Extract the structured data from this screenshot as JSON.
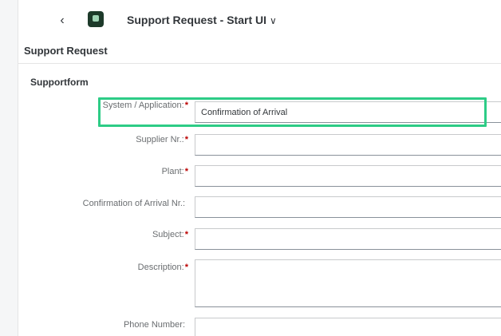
{
  "shell": {
    "back_icon": "chevron-left-icon",
    "app_icon": "app-logo-icon",
    "title": "Support Request - Start UI",
    "title_chevron": "∨"
  },
  "page": {
    "title": "Support Request"
  },
  "form": {
    "title": "Supportform",
    "fields": {
      "system": {
        "label": "System / Application:",
        "required": "*",
        "value": "Confirmation of Arrival"
      },
      "supplier": {
        "label": "Supplier Nr.:",
        "required": "*",
        "value": ""
      },
      "plant": {
        "label": "Plant:",
        "required": "*",
        "value": ""
      },
      "coa": {
        "label": "Confirmation of Arrival Nr.:",
        "value": ""
      },
      "subject": {
        "label": "Subject:",
        "required": "*",
        "value": ""
      },
      "description": {
        "label": "Description:",
        "required": "*",
        "value": ""
      },
      "phone": {
        "label": "Phone Number:",
        "value": ""
      }
    }
  },
  "colors": {
    "highlight": "#2dcc86",
    "required": "#bb0000"
  }
}
